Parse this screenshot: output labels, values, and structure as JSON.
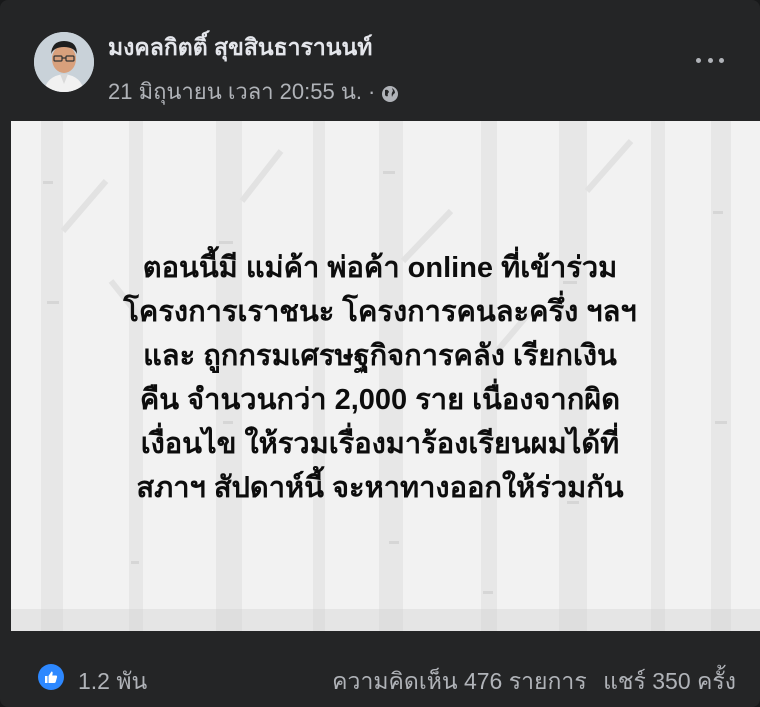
{
  "post": {
    "author": "มงคลกิตติ์ สุขสินธารานนท์",
    "date": "21 มิถุนายน เวลา 20:55 น.",
    "separator": "·",
    "privacy_icon": "globe-icon",
    "more_icon": "more-options-icon",
    "text_lines": [
      "ตอนนี้มี แม่ค้า พ่อค้า online ที่เข้าร่วม",
      "โครงการเราชนะ โครงการคนละครึ่ง ฯลฯ",
      "และ ถูกกรมเศรษฐกิจการคลัง เรียกเงิน",
      "คืน จำนวนกว่า 2,000 ราย เนื่องจากผิด",
      "เงื่อนไข ให้รวมเรื่องมาร้องเรียนผมได้ที่",
      "สภาฯ สัปดาห์นี้ จะหาทางออกให้ร่วมกัน"
    ]
  },
  "footer": {
    "like_icon": "like-thumb-icon",
    "reactions": "1.2 พัน",
    "comments": "ความคิดเห็น 476 รายการ",
    "shares": "แชร์ 350 ครั้ง"
  },
  "colors": {
    "card_bg": "#242526",
    "primary_text": "#e4e6eb",
    "secondary_text": "#b0b3b8",
    "like_blue": "#2d88ff",
    "banner_bg": "#f2f2f2"
  }
}
